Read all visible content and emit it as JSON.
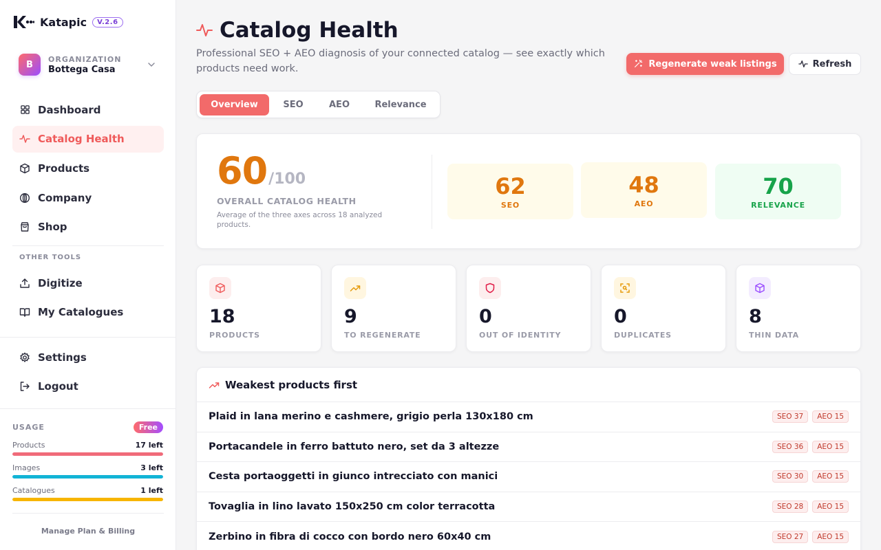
{
  "brand": {
    "name": "Katapic",
    "version": "V.2.6"
  },
  "organization": {
    "caption": "ORGANIZATION",
    "name": "Bottega Casa",
    "initial": "B"
  },
  "nav": {
    "items": [
      {
        "label": "Dashboard",
        "icon": "grid-icon"
      },
      {
        "label": "Catalog Health",
        "icon": "pulse-icon",
        "active": true
      },
      {
        "label": "Products",
        "icon": "box-icon"
      },
      {
        "label": "Company",
        "icon": "globe-icon"
      },
      {
        "label": "Shop",
        "icon": "shopping-bag-icon"
      }
    ],
    "other_tools_label": "OTHER TOOLS",
    "other_tools": [
      {
        "label": "Digitize",
        "icon": "upload-icon"
      },
      {
        "label": "My Catalogues",
        "icon": "book-icon"
      }
    ],
    "footer": [
      {
        "label": "Settings",
        "icon": "gear-icon"
      },
      {
        "label": "Logout",
        "icon": "logout-icon"
      }
    ]
  },
  "usage": {
    "title": "USAGE",
    "plan": "Free",
    "rows": [
      {
        "name": "Products",
        "value": "17 left",
        "fill": 1.0,
        "color": "#f06b7a"
      },
      {
        "name": "Images",
        "value": "3 left",
        "fill": 1.0,
        "color": "#12b4d6"
      },
      {
        "name": "Catalogues",
        "value": "1 left",
        "fill": 1.0,
        "color": "#f7b500"
      }
    ],
    "billing_link": "Manage Plan & Billing"
  },
  "page": {
    "title": "Catalog Health",
    "subtitle": "Professional SEO + AEO diagnosis of your connected catalog — see exactly which products need work.",
    "primary_button": "Regenerate weak listings",
    "secondary_button": "Refresh"
  },
  "tabs": [
    "Overview",
    "SEO",
    "AEO",
    "Relevance"
  ],
  "overall": {
    "score": "60",
    "out_of": "/100",
    "label": "OVERALL CATALOG HEALTH",
    "description": "Average of the three axes across 18 analyzed products."
  },
  "axes": [
    {
      "value": "62",
      "name": "SEO",
      "color": "#e0770e",
      "bg": "#fffbea"
    },
    {
      "value": "48",
      "name": "AEO",
      "color": "#e0770e",
      "bg": "#fffbea"
    },
    {
      "value": "70",
      "name": "RELEVANCE",
      "color": "#17a34a",
      "bg": "#effdf3"
    }
  ],
  "stats": [
    {
      "value": "18",
      "name": "PRODUCTS",
      "icon": "box-icon",
      "color": "#ef5a5a",
      "bg": "#fdeeee"
    },
    {
      "value": "9",
      "name": "TO REGENERATE",
      "icon": "trending-up-icon",
      "color": "#e59a0b",
      "bg": "#fff6e0"
    },
    {
      "value": "0",
      "name": "OUT OF IDENTITY",
      "icon": "shield-icon",
      "color": "#e11d48",
      "bg": "#fdeeee"
    },
    {
      "value": "0",
      "name": "DUPLICATES",
      "icon": "scan-icon",
      "color": "#e59a0b",
      "bg": "#fff6e0"
    },
    {
      "value": "8",
      "name": "THIN DATA",
      "icon": "cube-icon",
      "color": "#9a4dff",
      "bg": "#f3ecff"
    }
  ],
  "weakest": {
    "title": "Weakest products first",
    "rows": [
      {
        "name": "Plaid in lana merino e cashmere, grigio perla 130x180 cm",
        "seo": "SEO 37",
        "aeo": "AEO 15"
      },
      {
        "name": "Portacandele in ferro battuto nero, set da 3 altezze",
        "seo": "SEO 36",
        "aeo": "AEO 15"
      },
      {
        "name": "Cesta portaoggetti in giunco intrecciato con manici",
        "seo": "SEO 30",
        "aeo": "AEO 15"
      },
      {
        "name": "Tovaglia in lino lavato 150x250 cm color terracotta",
        "seo": "SEO 28",
        "aeo": "AEO 15"
      },
      {
        "name": "Zerbino in fibra di cocco con bordo nero 60x40 cm",
        "seo": "SEO 27",
        "aeo": "AEO 15"
      }
    ]
  }
}
